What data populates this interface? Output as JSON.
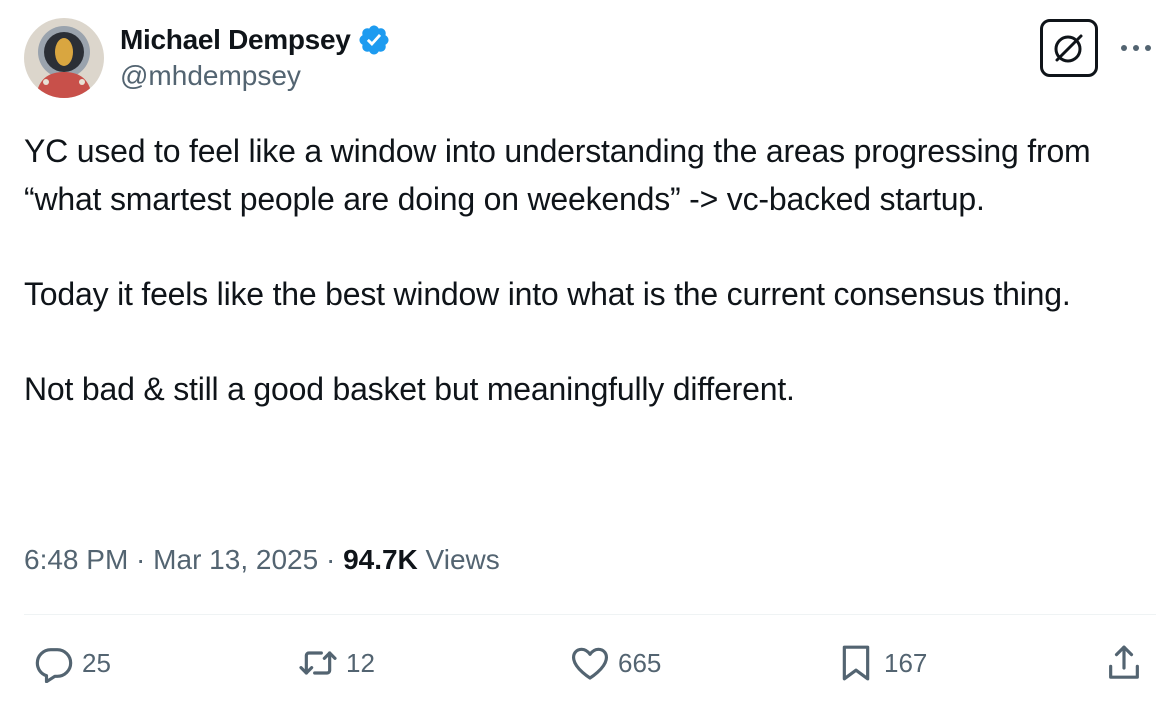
{
  "author": {
    "name": "Michael Dempsey",
    "handle": "@mhdempsey",
    "avatar_icon": "astronaut-avatar",
    "verified_icon": "verified-badge-icon",
    "verified_color": "#1d9bf0"
  },
  "header_actions": {
    "grok_icon": "grok-icon",
    "more_icon": "more-options-icon"
  },
  "tweet": {
    "paragraphs": [
      "YC used to feel like a window into understanding the areas progressing from “what smartest people are doing on weekends” -> vc-backed startup.",
      "Today it feels like the best window into what is the current consensus thing.",
      "Not bad & still a good basket but meaningfully different."
    ]
  },
  "meta": {
    "time": "6:48 PM",
    "separator": " · ",
    "date": "Mar 13, 2025",
    "views_count": "94.7K",
    "views_label": " Views"
  },
  "actions": {
    "reply": {
      "icon": "reply-icon",
      "count": "25"
    },
    "retweet": {
      "icon": "retweet-icon",
      "count": "12"
    },
    "like": {
      "icon": "heart-icon",
      "count": "665"
    },
    "bookmark": {
      "icon": "bookmark-icon",
      "count": "167"
    },
    "share": {
      "icon": "share-icon"
    }
  },
  "colors": {
    "text_primary": "#0f1419",
    "text_secondary": "#536471",
    "divider": "#eff3f4",
    "accent": "#1d9bf0"
  }
}
